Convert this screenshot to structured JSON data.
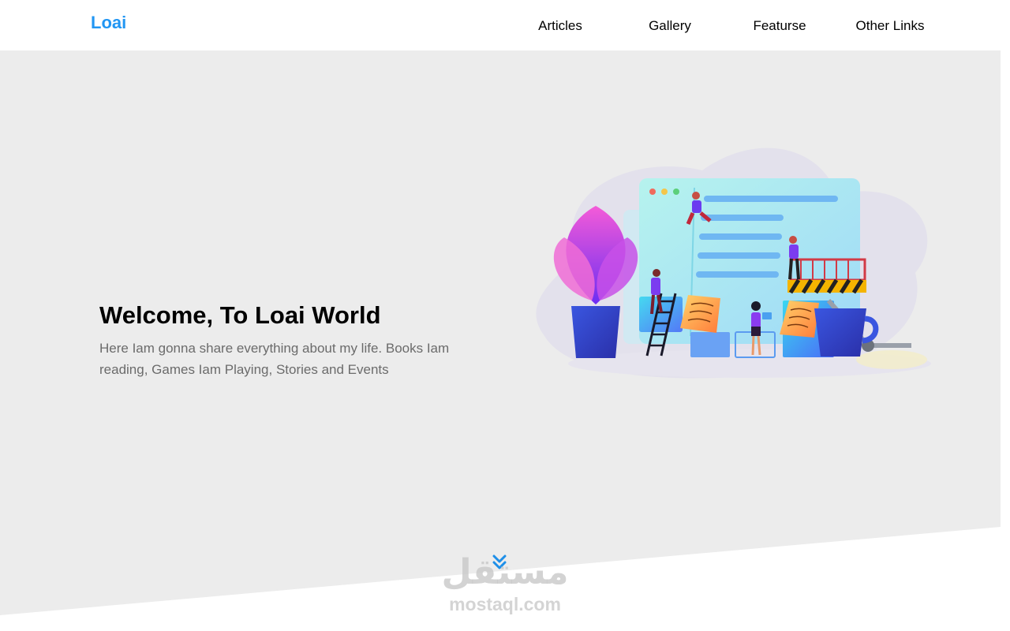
{
  "header": {
    "logo": "Loai",
    "nav": [
      {
        "label": "Articles"
      },
      {
        "label": "Gallery"
      },
      {
        "label": "Featurse"
      },
      {
        "label": "Other Links"
      }
    ]
  },
  "hero": {
    "title": "Welcome, To Loai World",
    "description": "Here Iam gonna share everything about my life. Books Iam reading, Games Iam Playing, Stories and Events",
    "illustration_icon": "website-construction-illustration",
    "scroll_icon": "double-chevron-down-icon"
  },
  "watermark": {
    "arabic": "مستقل",
    "latin": "mostaql.com"
  },
  "colors": {
    "accent": "#2196f3",
    "hero_bg": "#ececec",
    "text_muted": "#6b6b6b"
  }
}
